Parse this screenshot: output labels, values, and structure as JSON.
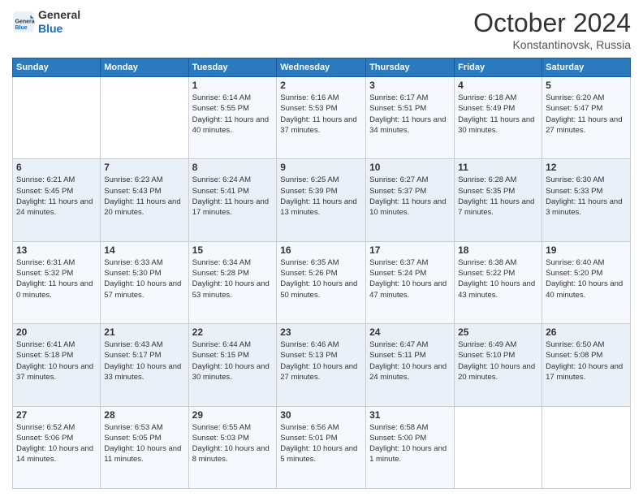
{
  "header": {
    "logo_general": "General",
    "logo_blue": "Blue",
    "month_title": "October 2024",
    "location": "Konstantinovsk, Russia"
  },
  "days_of_week": [
    "Sunday",
    "Monday",
    "Tuesday",
    "Wednesday",
    "Thursday",
    "Friday",
    "Saturday"
  ],
  "weeks": [
    [
      null,
      null,
      {
        "day": 1,
        "sunrise": "6:14 AM",
        "sunset": "5:55 PM",
        "daylight": "11 hours and 40 minutes."
      },
      {
        "day": 2,
        "sunrise": "6:16 AM",
        "sunset": "5:53 PM",
        "daylight": "11 hours and 37 minutes."
      },
      {
        "day": 3,
        "sunrise": "6:17 AM",
        "sunset": "5:51 PM",
        "daylight": "11 hours and 34 minutes."
      },
      {
        "day": 4,
        "sunrise": "6:18 AM",
        "sunset": "5:49 PM",
        "daylight": "11 hours and 30 minutes."
      },
      {
        "day": 5,
        "sunrise": "6:20 AM",
        "sunset": "5:47 PM",
        "daylight": "11 hours and 27 minutes."
      }
    ],
    [
      {
        "day": 6,
        "sunrise": "6:21 AM",
        "sunset": "5:45 PM",
        "daylight": "11 hours and 24 minutes."
      },
      {
        "day": 7,
        "sunrise": "6:23 AM",
        "sunset": "5:43 PM",
        "daylight": "11 hours and 20 minutes."
      },
      {
        "day": 8,
        "sunrise": "6:24 AM",
        "sunset": "5:41 PM",
        "daylight": "11 hours and 17 minutes."
      },
      {
        "day": 9,
        "sunrise": "6:25 AM",
        "sunset": "5:39 PM",
        "daylight": "11 hours and 13 minutes."
      },
      {
        "day": 10,
        "sunrise": "6:27 AM",
        "sunset": "5:37 PM",
        "daylight": "11 hours and 10 minutes."
      },
      {
        "day": 11,
        "sunrise": "6:28 AM",
        "sunset": "5:35 PM",
        "daylight": "11 hours and 7 minutes."
      },
      {
        "day": 12,
        "sunrise": "6:30 AM",
        "sunset": "5:33 PM",
        "daylight": "11 hours and 3 minutes."
      }
    ],
    [
      {
        "day": 13,
        "sunrise": "6:31 AM",
        "sunset": "5:32 PM",
        "daylight": "11 hours and 0 minutes."
      },
      {
        "day": 14,
        "sunrise": "6:33 AM",
        "sunset": "5:30 PM",
        "daylight": "10 hours and 57 minutes."
      },
      {
        "day": 15,
        "sunrise": "6:34 AM",
        "sunset": "5:28 PM",
        "daylight": "10 hours and 53 minutes."
      },
      {
        "day": 16,
        "sunrise": "6:35 AM",
        "sunset": "5:26 PM",
        "daylight": "10 hours and 50 minutes."
      },
      {
        "day": 17,
        "sunrise": "6:37 AM",
        "sunset": "5:24 PM",
        "daylight": "10 hours and 47 minutes."
      },
      {
        "day": 18,
        "sunrise": "6:38 AM",
        "sunset": "5:22 PM",
        "daylight": "10 hours and 43 minutes."
      },
      {
        "day": 19,
        "sunrise": "6:40 AM",
        "sunset": "5:20 PM",
        "daylight": "10 hours and 40 minutes."
      }
    ],
    [
      {
        "day": 20,
        "sunrise": "6:41 AM",
        "sunset": "5:18 PM",
        "daylight": "10 hours and 37 minutes."
      },
      {
        "day": 21,
        "sunrise": "6:43 AM",
        "sunset": "5:17 PM",
        "daylight": "10 hours and 33 minutes."
      },
      {
        "day": 22,
        "sunrise": "6:44 AM",
        "sunset": "5:15 PM",
        "daylight": "10 hours and 30 minutes."
      },
      {
        "day": 23,
        "sunrise": "6:46 AM",
        "sunset": "5:13 PM",
        "daylight": "10 hours and 27 minutes."
      },
      {
        "day": 24,
        "sunrise": "6:47 AM",
        "sunset": "5:11 PM",
        "daylight": "10 hours and 24 minutes."
      },
      {
        "day": 25,
        "sunrise": "6:49 AM",
        "sunset": "5:10 PM",
        "daylight": "10 hours and 20 minutes."
      },
      {
        "day": 26,
        "sunrise": "6:50 AM",
        "sunset": "5:08 PM",
        "daylight": "10 hours and 17 minutes."
      }
    ],
    [
      {
        "day": 27,
        "sunrise": "6:52 AM",
        "sunset": "5:06 PM",
        "daylight": "10 hours and 14 minutes."
      },
      {
        "day": 28,
        "sunrise": "6:53 AM",
        "sunset": "5:05 PM",
        "daylight": "10 hours and 11 minutes."
      },
      {
        "day": 29,
        "sunrise": "6:55 AM",
        "sunset": "5:03 PM",
        "daylight": "10 hours and 8 minutes."
      },
      {
        "day": 30,
        "sunrise": "6:56 AM",
        "sunset": "5:01 PM",
        "daylight": "10 hours and 5 minutes."
      },
      {
        "day": 31,
        "sunrise": "6:58 AM",
        "sunset": "5:00 PM",
        "daylight": "10 hours and 1 minute."
      },
      null,
      null
    ]
  ]
}
